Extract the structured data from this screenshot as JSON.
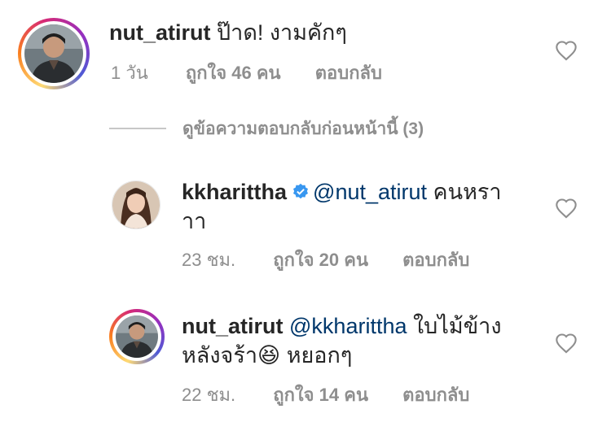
{
  "comments": [
    {
      "username": "nut_atirut",
      "mention": "",
      "text": "ป๊าด! งามคักๆ",
      "time": "1 วัน",
      "likes": "ถูกใจ 46 คน",
      "reply": "ตอบกลับ"
    }
  ],
  "view_replies": "ดูข้อความตอบกลับก่อนหน้านี้ (3)",
  "replies": [
    {
      "username": "kkharittha",
      "verified": true,
      "mention": "@nut_atirut",
      "text_line1": "คนหรา",
      "text_line2": "าา",
      "time": "23 ชม.",
      "likes": "ถูกใจ 20 คน",
      "reply": "ตอบกลับ"
    },
    {
      "username": "nut_atirut",
      "verified": false,
      "mention": "@kkharittha",
      "text_line1": "ใบไม้ข้าง",
      "text_line2a": "หลังจร้า",
      "emoji": "😆",
      "text_line2b": "หยอกๆ",
      "time": "22 ชม.",
      "likes": "ถูกใจ 14 คน",
      "reply": "ตอบกลับ"
    }
  ],
  "icons": {
    "heart": "heart-outline-icon",
    "verified": "verified-badge-icon"
  },
  "colors": {
    "text": "#262626",
    "meta": "#8e8e8e",
    "mention": "#00376b",
    "verified": "#3897f0"
  }
}
